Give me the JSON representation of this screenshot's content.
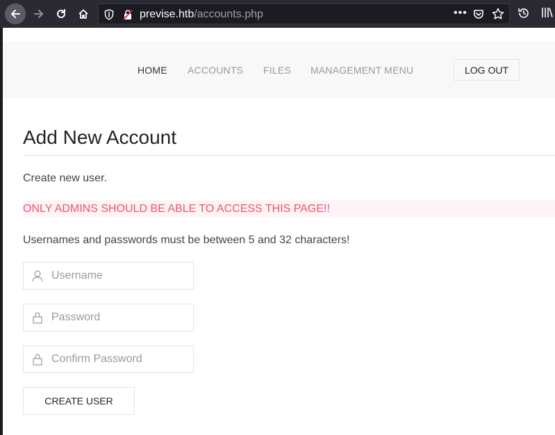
{
  "browser": {
    "url_host": "previse.htb",
    "url_path": "/accounts.php",
    "more_label": "•••"
  },
  "nav": {
    "items": [
      {
        "label": "HOME",
        "active": true
      },
      {
        "label": "ACCOUNTS",
        "active": false
      },
      {
        "label": "FILES",
        "active": false
      },
      {
        "label": "MANAGEMENT MENU",
        "active": false
      }
    ],
    "logout_label": "LOG OUT"
  },
  "main": {
    "title": "Add New Account",
    "intro": "Create new user.",
    "warning": "ONLY ADMINS SHOULD BE ABLE TO ACCESS THIS PAGE!!",
    "rules": "Usernames and passwords must be between 5 and 32 characters!"
  },
  "form": {
    "username_placeholder": "Username",
    "password_placeholder": "Password",
    "confirm_placeholder": "Confirm Password",
    "submit_label": "CREATE USER"
  },
  "icons": {
    "back": "arrow-left-icon",
    "forward": "arrow-right-icon",
    "reload": "reload-icon",
    "home": "home-icon",
    "tracking": "shield-icon",
    "insecure": "insecure-lock-icon",
    "pocket": "pocket-icon",
    "bookmark": "star-icon",
    "history": "history-icon",
    "library": "library-icon",
    "user": "user-icon",
    "lock": "lock-icon"
  },
  "colors": {
    "warning_text": "#f0506e",
    "warning_bg": "#fef4f6",
    "nav_bg": "#f8f8f8",
    "browser_chrome": "#2b2a33"
  }
}
